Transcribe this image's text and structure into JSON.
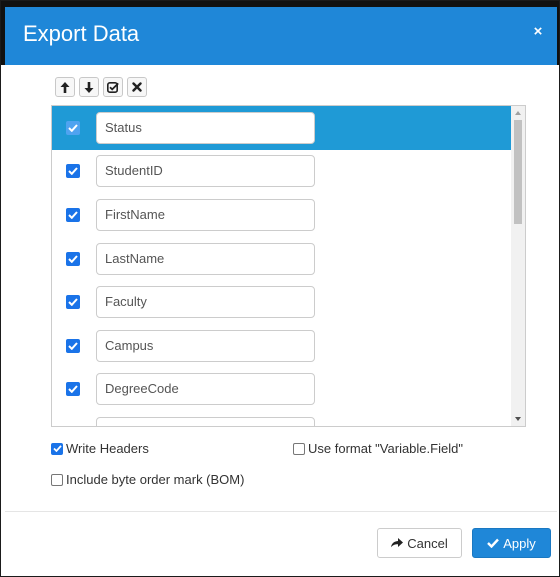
{
  "dialog": {
    "title": "Export Data",
    "close_symbol": "×"
  },
  "toolbar": {
    "buttons": [
      {
        "icon": "arrow-up-icon"
      },
      {
        "icon": "arrow-down-icon"
      },
      {
        "icon": "check-all-icon"
      },
      {
        "icon": "clear-icon"
      }
    ]
  },
  "fields": [
    {
      "name": "Status",
      "checked": true,
      "selected": true
    },
    {
      "name": "StudentID",
      "checked": true,
      "selected": false
    },
    {
      "name": "FirstName",
      "checked": true,
      "selected": false
    },
    {
      "name": "LastName",
      "checked": true,
      "selected": false
    },
    {
      "name": "Faculty",
      "checked": true,
      "selected": false
    },
    {
      "name": "Campus",
      "checked": true,
      "selected": false
    },
    {
      "name": "DegreeCode",
      "checked": true,
      "selected": false
    },
    {
      "name": "",
      "checked": true,
      "selected": false
    }
  ],
  "options": {
    "write_headers": {
      "label": "Write Headers",
      "checked": true
    },
    "use_format": {
      "label": "Use format \"Variable.Field\"",
      "checked": false
    },
    "include_bom": {
      "label": "Include byte order mark (BOM)",
      "checked": false
    }
  },
  "footer": {
    "cancel_label": "Cancel",
    "apply_label": "Apply"
  },
  "colors": {
    "header": "#1f87d8",
    "selected_row": "#1f9ad6",
    "checkbox": "#1a73e8"
  }
}
